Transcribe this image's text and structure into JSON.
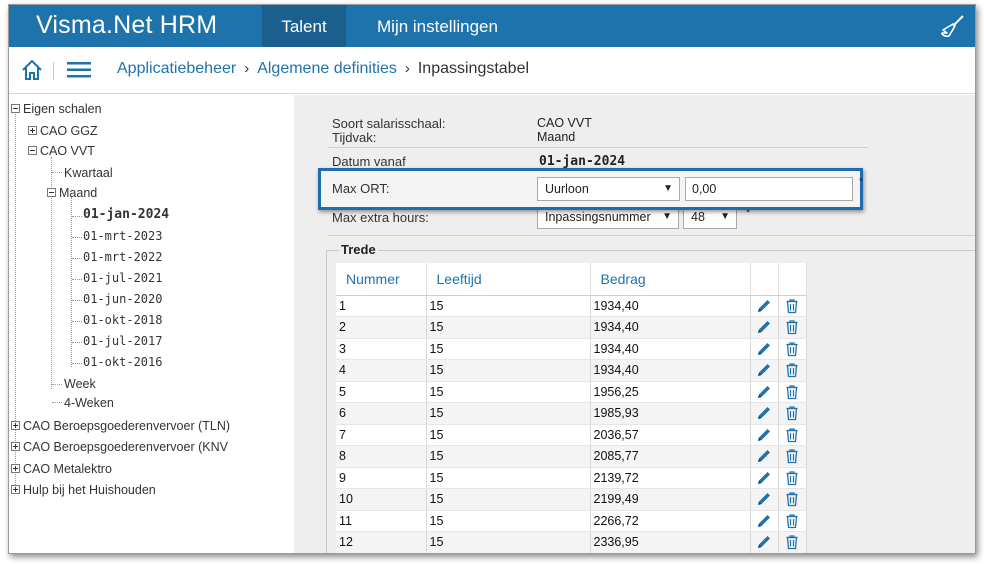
{
  "header": {
    "app_title": "Visma.Net HRM",
    "tabs": [
      {
        "label": "Talent",
        "active": true
      },
      {
        "label": "Mijn instellingen",
        "active": false
      }
    ],
    "colors": {
      "brand": "#1e73ad",
      "active_tab": "#1a5f8e"
    },
    "right_icon": "broom-icon"
  },
  "breadcrumb": {
    "items": [
      "Applicatiebeheer",
      "Algemene definities",
      "Inpassingstabel"
    ],
    "separator": "›"
  },
  "tree": {
    "root": "Eigen schalen",
    "nodes": [
      {
        "label": "CAO GGZ",
        "state": "collapsed"
      },
      {
        "label": "CAO VVT",
        "state": "expanded"
      },
      {
        "label": "Kwartaal"
      },
      {
        "label": "Maand",
        "state": "expanded"
      },
      {
        "label": "01-jan-2024",
        "selected": true
      },
      {
        "label": "01-mrt-2023"
      },
      {
        "label": "01-mrt-2022"
      },
      {
        "label": "01-jul-2021"
      },
      {
        "label": "01-jun-2020"
      },
      {
        "label": "01-okt-2018"
      },
      {
        "label": "01-jul-2017"
      },
      {
        "label": "01-okt-2016"
      },
      {
        "label": "Week"
      },
      {
        "label": "4-Weken"
      },
      {
        "label": "CAO Beroepsgoederenvervoer (TLN)",
        "state": "collapsed"
      },
      {
        "label": "CAO Beroepsgoederenvervoer (KNV",
        "state": "collapsed"
      },
      {
        "label": "CAO Metalektro",
        "state": "collapsed"
      },
      {
        "label": "Hulp bij het Huishouden",
        "state": "collapsed"
      }
    ]
  },
  "form": {
    "soort_label": "Soort salarisschaal:",
    "soort_value": "CAO VVT",
    "tijdvak_label": "Tijdvak:",
    "tijdvak_value": "Maand",
    "datum_label": "Datum vanaf",
    "datum_value": "01-jan-2024",
    "max_ort_label": "Max ORT:",
    "max_ort_select": "Uurloon",
    "max_ort_value": "0,00",
    "max_extra_label": "Max extra hours:",
    "max_extra_select": "Inpassingsnummer",
    "max_extra_number": "48",
    "required_mark": "*"
  },
  "trede": {
    "legend": "Trede",
    "columns": [
      "Nummer",
      "Leeftijd",
      "Bedrag"
    ],
    "rows": [
      [
        "1",
        "15",
        "1934,40"
      ],
      [
        "2",
        "15",
        "1934,40"
      ],
      [
        "3",
        "15",
        "1934,40"
      ],
      [
        "4",
        "15",
        "1934,40"
      ],
      [
        "5",
        "15",
        "1956,25"
      ],
      [
        "6",
        "15",
        "1985,93"
      ],
      [
        "7",
        "15",
        "2036,57"
      ],
      [
        "8",
        "15",
        "2085,77"
      ],
      [
        "9",
        "15",
        "2139,72"
      ],
      [
        "10",
        "15",
        "2199,49"
      ],
      [
        "11",
        "15",
        "2266,72"
      ],
      [
        "12",
        "15",
        "2336,95"
      ]
    ],
    "row_icons": [
      "pencil-icon",
      "trash-icon"
    ]
  }
}
